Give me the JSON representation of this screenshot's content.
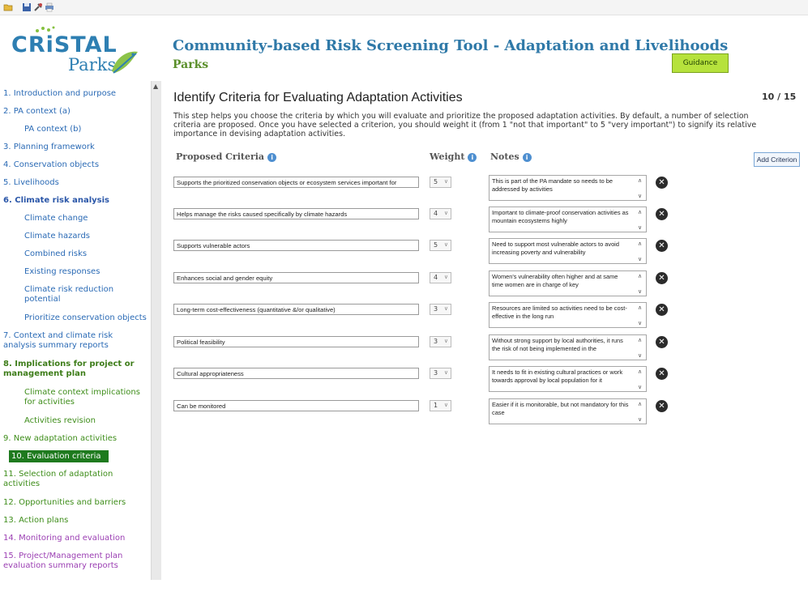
{
  "app": {
    "title": "Community-based Risk Screening Tool - Adaptation and Livelihoods",
    "subtitle": "Parks",
    "guidance_label": "Guidance",
    "logo_text_main": "CRiSTAL",
    "logo_text_sub": "Parks"
  },
  "toolbar": {
    "icons": [
      "open-folder-icon",
      "save-icon",
      "tools-icon",
      "print-icon"
    ]
  },
  "sidebar": {
    "items": [
      {
        "label": "1. Introduction and purpose",
        "color": "#2a6ab5"
      },
      {
        "label": "2. PA context (a)",
        "color": "#2a6ab5"
      },
      {
        "label": "PA context (b)",
        "color": "#2a6ab5"
      },
      {
        "label": "3. Planning framework",
        "color": "#2a6ab5"
      },
      {
        "label": "4. Conservation objects",
        "color": "#2a6ab5"
      },
      {
        "label": "5. Livelihoods",
        "color": "#2a6ab5"
      },
      {
        "label": "6. Climate risk analysis",
        "color": "#2a56a8"
      },
      {
        "label": "Climate change",
        "color": "#2a6ab5"
      },
      {
        "label": "Climate hazards",
        "color": "#2a6ab5"
      },
      {
        "label": "Combined risks",
        "color": "#2a6ab5"
      },
      {
        "label": "Existing responses",
        "color": "#2a6ab5"
      },
      {
        "label": "Climate risk reduction potential",
        "color": "#2a6ab5"
      },
      {
        "label": "Prioritize conservation objects",
        "color": "#2a6ab5"
      },
      {
        "label": "7. Context and climate risk analysis summary reports",
        "color": "#2a6ab5"
      },
      {
        "label": "8. Implications for project or management plan",
        "color": "#3e7d1a"
      },
      {
        "label": "Climate context implications for activities",
        "color": "#3e8d1a"
      },
      {
        "label": "Activities revision",
        "color": "#3e8d1a"
      },
      {
        "label": "9. New adaptation activities",
        "color": "#3e8d1a"
      },
      {
        "label": "10. Evaluation criteria",
        "color": "#ffffff"
      },
      {
        "label": "11. Selection of adaptation activities",
        "color": "#3e8d1a"
      },
      {
        "label": "12. Opportunities and barriers",
        "color": "#3e8d1a"
      },
      {
        "label": "13. Action plans",
        "color": "#3e8d1a"
      },
      {
        "label": "14. Monitoring and evaluation",
        "color": "#9b3fb3"
      },
      {
        "label": "15. Project/Management plan evaluation summary reports",
        "color": "#9b3fb3"
      }
    ],
    "active_bg": "#1e7a1e"
  },
  "main": {
    "heading": "Identify Criteria for Evaluating Adaptation Activities",
    "pager": "10 / 15",
    "intro": "This step helps you choose the criteria by which you will evaluate and prioritize the proposed adaptation activities. By default, a number of selection criteria are proposed. Once you have selected a criterion, you should weight it (from 1 \"not that important\" to 5 \"very important\") to signify its relative importance in devising adaptation activities.",
    "col_criteria": "Proposed Criteria",
    "col_weight": "Weight",
    "col_notes": "Notes",
    "add_button": "Add Criterion",
    "rows": [
      {
        "criterion": "Supports the prioritized conservation objects or ecosystem services important for",
        "weight": "5",
        "note": "This is part of the PA mandate so needs to be addressed by activities"
      },
      {
        "criterion": "Helps manage the risks caused specifically by climate hazards",
        "weight": "4",
        "note": "Important to climate-proof conservation activities as mountain ecosystems highly"
      },
      {
        "criterion": "Supports vulnerable actors",
        "weight": "5",
        "note": "Need to support most vulnerable actors to avoid increasing poverty and vulnerability"
      },
      {
        "criterion": "Enhances social and gender equity",
        "weight": "4",
        "note": "Women's vulnerability often higher and at same time women are in charge of key"
      },
      {
        "criterion": "Long-term cost-effectiveness (quantitative &/or qualitative)",
        "weight": "3",
        "note": "Resources are limited so activities need to be cost-effective in the long run"
      },
      {
        "criterion": "Political feasibility",
        "weight": "3",
        "note": "Without strong support by local authorities, it runs the risk of not being implemented in the"
      },
      {
        "criterion": "Cultural appropriateness",
        "weight": "3",
        "note": "It needs to fit in existing cultural practices or work towards approval by local population for it"
      },
      {
        "criterion": "Can be monitored",
        "weight": "1",
        "note": "Easier if it is monitorable, but not mandatory for this case"
      }
    ]
  }
}
